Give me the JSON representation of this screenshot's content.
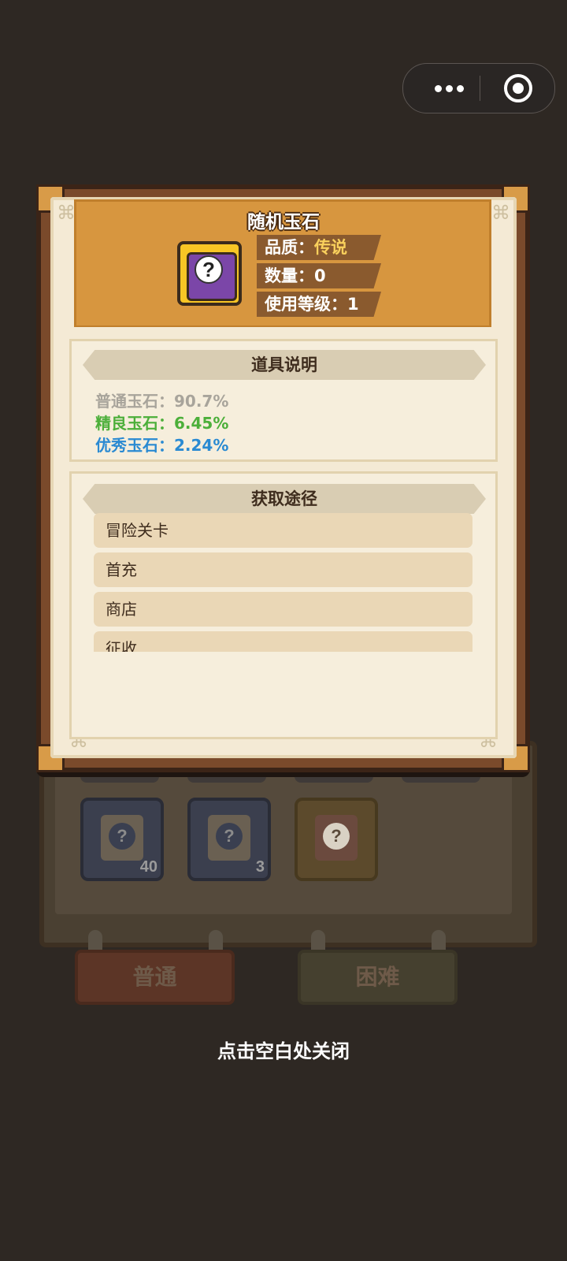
{
  "capsule": {
    "more_icon": "more-dots-icon",
    "close_icon": "target-close-icon"
  },
  "item": {
    "title": "随机玉石",
    "icon": "mystery-chest-icon",
    "quality_label": "品质：",
    "quality_value": "传说",
    "quantity_label": "数量：",
    "quantity_value": "0",
    "level_label": "使用等级：",
    "level_value": "1"
  },
  "description": {
    "title": "道具说明",
    "rates": [
      {
        "text": "普通玉石：90.7%",
        "color": "#a8a49b"
      },
      {
        "text": "精良玉石：6.45%",
        "color": "#4caf3a"
      },
      {
        "text": "优秀玉石：2.24%",
        "color": "#2a8ad2"
      }
    ]
  },
  "sources": {
    "title": "获取途径",
    "items": [
      "冒险关卡",
      "首充",
      "商店",
      "征收"
    ]
  },
  "background": {
    "slot_counts": [
      "40",
      "3"
    ],
    "tabs": [
      "普通",
      "困难"
    ]
  },
  "close_hint": "点击空白处关闭",
  "colors": {
    "legend": "#f9d05c",
    "banner": "#d7963f",
    "paper": "#f4ead5",
    "frame": "#7a4a2b"
  }
}
